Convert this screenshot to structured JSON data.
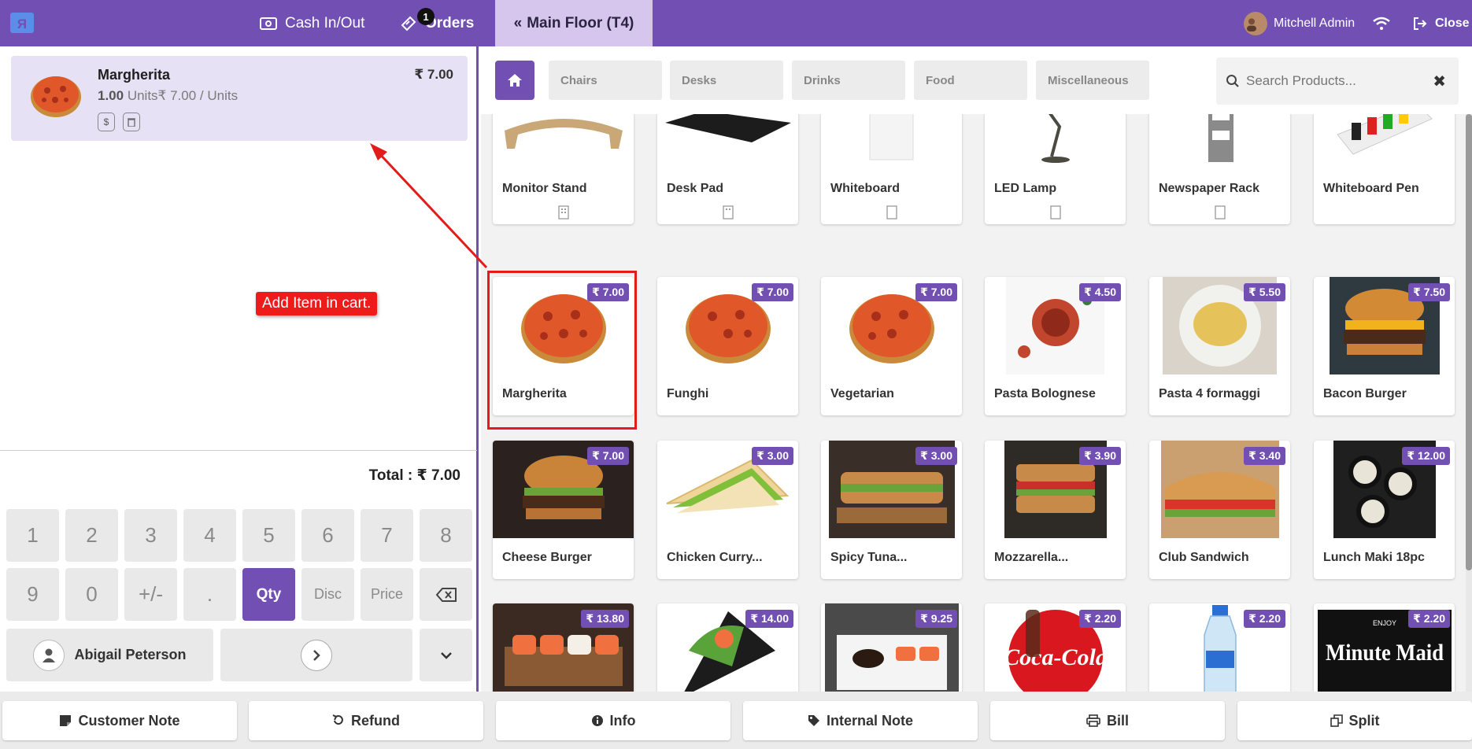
{
  "header": {
    "cash_label": "Cash In/Out",
    "orders_label": "Orders",
    "orders_count": "1",
    "floor_label": "Main Floor (T4)",
    "user_name": "Mitchell Admin",
    "close_label": "Close"
  },
  "order": {
    "line": {
      "name": "Margherita",
      "price": "₹ 7.00",
      "qty": "1.00",
      "unit_info": "Units₹ 7.00 / Units"
    },
    "total": "Total : ₹ 7.00",
    "annotation": "Add Item in cart."
  },
  "numpad": {
    "keys": [
      "1",
      "2",
      "3",
      "4",
      "5",
      "6",
      "7",
      "8",
      "9",
      "0",
      "+/-",
      ".",
      "Qty",
      "Disc",
      "Price"
    ],
    "customer": "Abigail Peterson"
  },
  "categories": [
    "Chairs",
    "Desks",
    "Drinks",
    "Food",
    "Miscellaneous"
  ],
  "search": {
    "placeholder": "Search Products..."
  },
  "products": [
    {
      "name": "Monitor Stand",
      "price": ""
    },
    {
      "name": "Desk Pad",
      "price": ""
    },
    {
      "name": "Whiteboard",
      "price": ""
    },
    {
      "name": "LED Lamp",
      "price": ""
    },
    {
      "name": "Newspaper Rack",
      "price": ""
    },
    {
      "name": "Whiteboard Pen",
      "price": ""
    },
    {
      "name": "Margherita",
      "price": "₹ 7.00"
    },
    {
      "name": "Funghi",
      "price": "₹ 7.00"
    },
    {
      "name": "Vegetarian",
      "price": "₹ 7.00"
    },
    {
      "name": "Pasta Bolognese",
      "price": "₹ 4.50"
    },
    {
      "name": "Pasta 4 formaggi",
      "price": "₹ 5.50"
    },
    {
      "name": "Bacon Burger",
      "price": "₹ 7.50"
    },
    {
      "name": "Cheese Burger",
      "price": "₹ 7.00"
    },
    {
      "name": "Chicken Curry...",
      "price": "₹ 3.00"
    },
    {
      "name": "Spicy Tuna...",
      "price": "₹ 3.00"
    },
    {
      "name": "Mozzarella...",
      "price": "₹ 3.90"
    },
    {
      "name": "Club Sandwich",
      "price": "₹ 3.40"
    },
    {
      "name": "Lunch Maki 18pc",
      "price": "₹ 12.00"
    },
    {
      "name": "",
      "price": "₹ 13.80"
    },
    {
      "name": "",
      "price": "₹ 14.00"
    },
    {
      "name": "",
      "price": "₹ 9.25"
    },
    {
      "name": "",
      "price": "₹ 2.20"
    },
    {
      "name": "",
      "price": "₹ 2.20"
    },
    {
      "name": "",
      "price": "₹ 2.20"
    }
  ],
  "image_text": {
    "coca_cola": "Coca-Cola",
    "minute_maid": "Minute Maid",
    "enjoy": "ENJOY"
  },
  "actions": [
    "Customer Note",
    "Refund",
    "Info",
    "Internal Note",
    "Bill",
    "Split"
  ],
  "colors": {
    "brand": "#714fb3",
    "highlight": "#e41b1b"
  }
}
